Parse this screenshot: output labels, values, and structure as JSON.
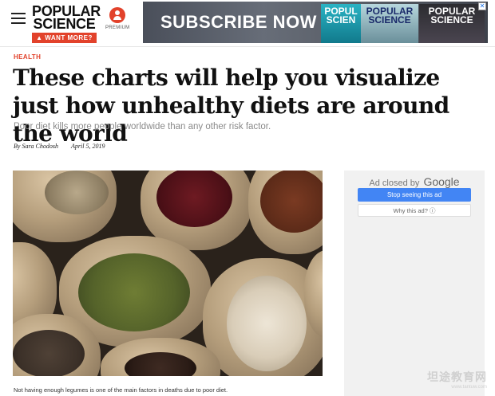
{
  "header": {
    "logo_line1": "POPULAR",
    "logo_line2": "SCIENCE",
    "want_more": "▲ WANT MORE?",
    "premium_label": "PREMIUM",
    "brand_color": "#e2422b"
  },
  "banner_ad": {
    "text": "SUBSCRIBE NOW",
    "mag_titles": [
      "POPUL SCIEN",
      "POPULAR SCIENCE",
      "POPULAR SCIENCE"
    ],
    "close_label": "✕"
  },
  "article": {
    "category": "HEALTH",
    "headline": "These charts will help you visualize just how unhealthy diets are around the world",
    "subhead": "Poor diet kills more people worldwide than any other risk factor.",
    "author": "By Sara Chodosh",
    "date": "April 5, 2019",
    "caption": "Not having enough legumes is one of the main factors in deaths due to poor diet."
  },
  "side_ad": {
    "closed_by": "Ad closed by",
    "google": "Google",
    "stop_label": "Stop seeing this ad",
    "why_label": "Why this ad? ⓘ"
  },
  "watermark": {
    "cn": "坦途教育网",
    "url": "www.tantuw.com"
  }
}
